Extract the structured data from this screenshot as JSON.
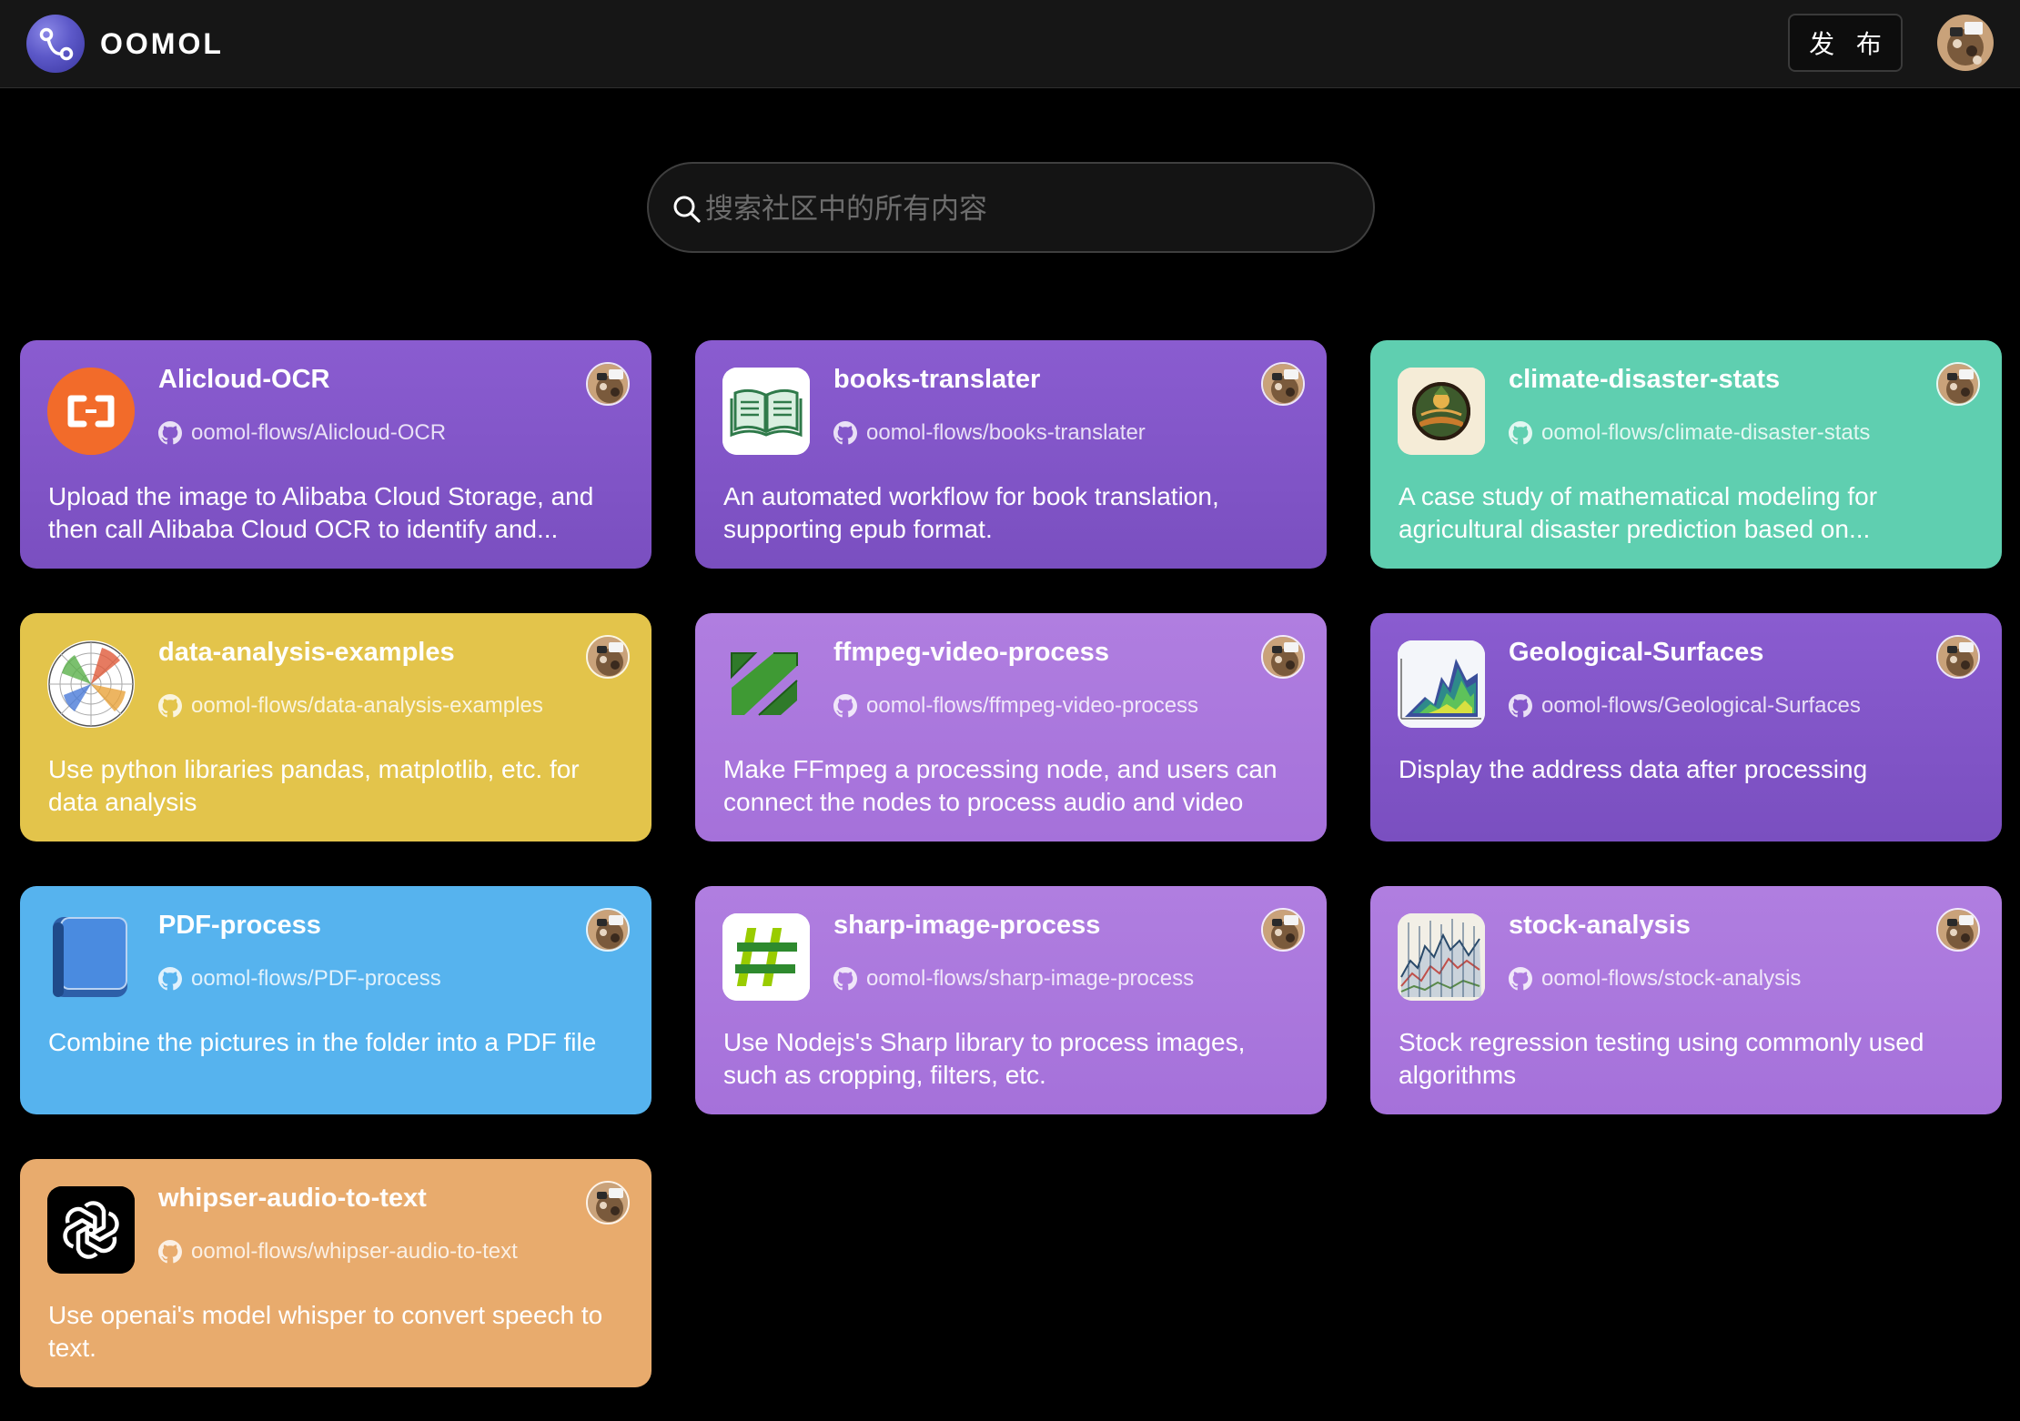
{
  "header": {
    "logo_text": "OOMOL",
    "publish_label": "发 布"
  },
  "search": {
    "placeholder": "搜索社区中的所有内容"
  },
  "cards": [
    {
      "title": "Alicloud-OCR",
      "repo": "oomol-flows/Alicloud-OCR",
      "description": "Upload the image to Alibaba Cloud Storage, and then call Alibaba Cloud OCR to identify and...",
      "icon": "alicloud-icon",
      "color": "#7f55c5"
    },
    {
      "title": "books-translater",
      "repo": "oomol-flows/books-translater",
      "description": "An automated workflow for book translation, supporting epub format.",
      "icon": "open-book-icon",
      "color": "#7f55c5"
    },
    {
      "title": "climate-disaster-stats",
      "repo": "oomol-flows/climate-disaster-stats",
      "description": "A case study of mathematical modeling for agricultural disaster prediction based on...",
      "icon": "climate-globe-icon",
      "color": "#5fcfb0"
    },
    {
      "title": "data-analysis-examples",
      "repo": "oomol-flows/data-analysis-examples",
      "description": "Use python libraries pandas, matplotlib, etc. for data analysis",
      "icon": "polar-chart-icon",
      "color": "#e3c44b"
    },
    {
      "title": "ffmpeg-video-process",
      "repo": "oomol-flows/ffmpeg-video-process",
      "description": "Make FFmpeg a processing node, and users can connect the nodes to process audio and video",
      "icon": "ffmpeg-icon",
      "color": "#ab77dd"
    },
    {
      "title": "Geological-Surfaces",
      "repo": "oomol-flows/Geological-Surfaces",
      "description": "Display the address data after processing",
      "icon": "surface-plot-icon",
      "color": "#7f55c5"
    },
    {
      "title": "PDF-process",
      "repo": "oomol-flows/PDF-process",
      "description": "Combine the pictures in the folder into a PDF file",
      "icon": "blue-book-icon",
      "color": "#56b3ee"
    },
    {
      "title": "sharp-image-process",
      "repo": "oomol-flows/sharp-image-process",
      "description": "Use Nodejs's Sharp library to process images, such as cropping, filters, etc.",
      "icon": "sharp-hash-icon",
      "color": "#ab77dd"
    },
    {
      "title": "stock-analysis",
      "repo": "oomol-flows/stock-analysis",
      "description": "Stock regression testing using commonly used algorithms",
      "icon": "stock-chart-icon",
      "color": "#ab77dd"
    },
    {
      "title": "whipser-audio-to-text",
      "repo": "oomol-flows/whipser-audio-to-text",
      "description": "Use openai's model whisper to convert speech to text.",
      "icon": "openai-icon",
      "color": "#e8ab6d"
    }
  ]
}
